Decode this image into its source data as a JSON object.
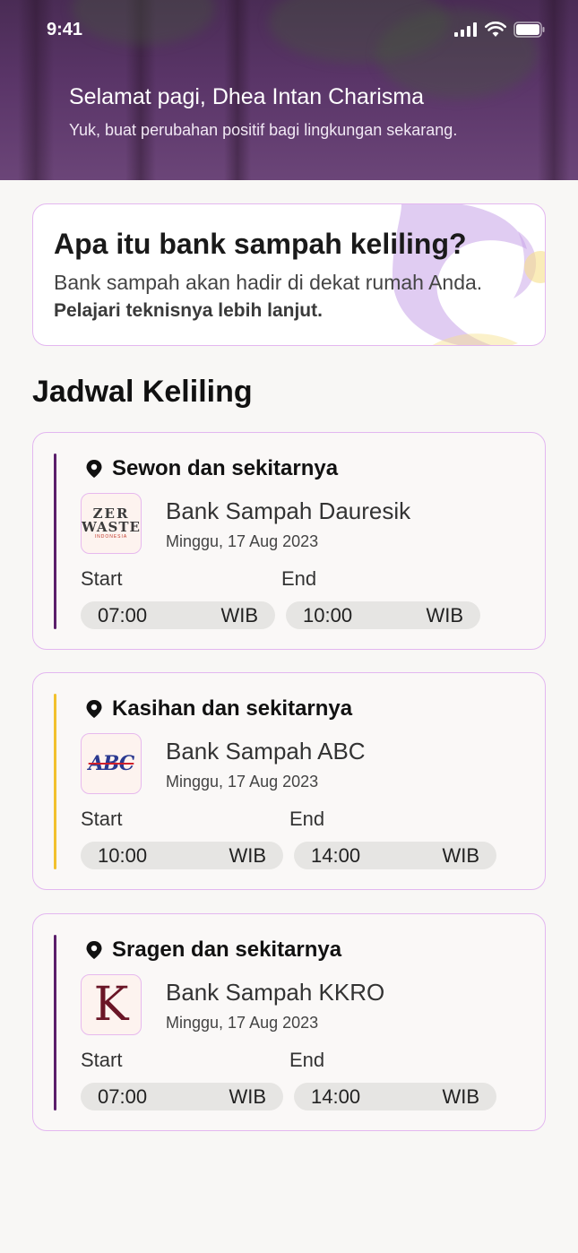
{
  "status": {
    "time": "9:41"
  },
  "header": {
    "greeting": "Selamat pagi, Dhea Intan Charisma",
    "subtitle": "Yuk, buat perubahan positif bagi lingkungan sekarang."
  },
  "info": {
    "title": "Apa itu bank sampah keliling?",
    "text": "Bank sampah akan hadir di dekat rumah Anda.",
    "link": "Pelajari teknisnya lebih lanjut."
  },
  "section_title": "Jadwal Keliling",
  "labels": {
    "start": "Start",
    "end": "End",
    "tz": "WIB"
  },
  "schedules": [
    {
      "location": "Sewon dan sekitarnya",
      "bank": "Bank Sampah Dauresik",
      "date": "Minggu, 17 Aug 2023",
      "start": "07:00",
      "end": "10:00",
      "accent": "#5b1f6b",
      "logo": "ZERO WASTE",
      "logo_top": "ZER",
      "logo_bottom": "WASTE",
      "logo_sub": "INDONESIA"
    },
    {
      "location": "Kasihan dan sekitarnya",
      "bank": "Bank Sampah ABC",
      "date": "Minggu, 17 Aug 2023",
      "start": "10:00",
      "end": "14:00",
      "accent": "#f2c12e",
      "logo": "ABC"
    },
    {
      "location": "Sragen dan sekitarnya",
      "bank": "Bank Sampah KKRO",
      "date": "Minggu, 17 Aug 2023",
      "start": "07:00",
      "end": "14:00",
      "accent": "#5b1f6b",
      "logo": "K"
    }
  ]
}
